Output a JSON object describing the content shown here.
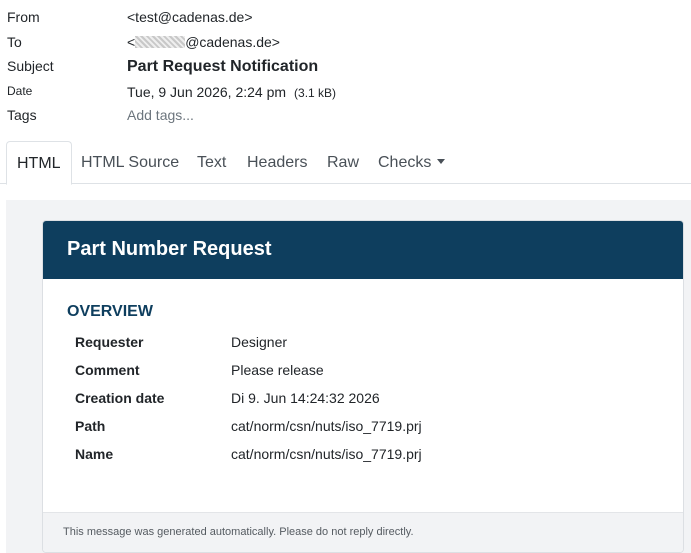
{
  "headers": {
    "from_label": "From",
    "from_value": "<test@cadenas.de>",
    "to_label": "To",
    "to_prefix": "<",
    "to_suffix": "@cadenas.de>",
    "subject_label": "Subject",
    "subject_value": "Part Request Notification",
    "date_label": "Date",
    "date_value": "Tue, 9 Jun 2026, 2:24 pm",
    "size_value": "(3.1 kB)",
    "tags_label": "Tags",
    "tags_placeholder": "Add tags..."
  },
  "tabs": [
    {
      "label": "HTML",
      "active": true
    },
    {
      "label": "HTML Source",
      "active": false
    },
    {
      "label": "Text",
      "active": false
    },
    {
      "label": "Headers",
      "active": false
    },
    {
      "label": "Raw",
      "active": false
    },
    {
      "label": "Checks",
      "active": false,
      "dropdown": true
    }
  ],
  "email": {
    "title": "Part Number Request",
    "section_title": "OVERVIEW",
    "fields": [
      {
        "key": "Requester",
        "value": "Designer"
      },
      {
        "key": "Comment",
        "value": "Please release"
      },
      {
        "key": "Creation date",
        "value": "Di 9. Jun 14:24:32 2026"
      },
      {
        "key": "Path",
        "value": "cat/norm/csn/nuts/iso_7719.prj"
      },
      {
        "key": "Name",
        "value": "cat/norm/csn/nuts/iso_7719.prj"
      }
    ],
    "footer": "This message was generated automatically. Please do not reply directly."
  },
  "colors": {
    "header_bg": "#0e3e5e",
    "section_title": "#0e3e5e",
    "preview_bg": "#f2f3f5"
  }
}
